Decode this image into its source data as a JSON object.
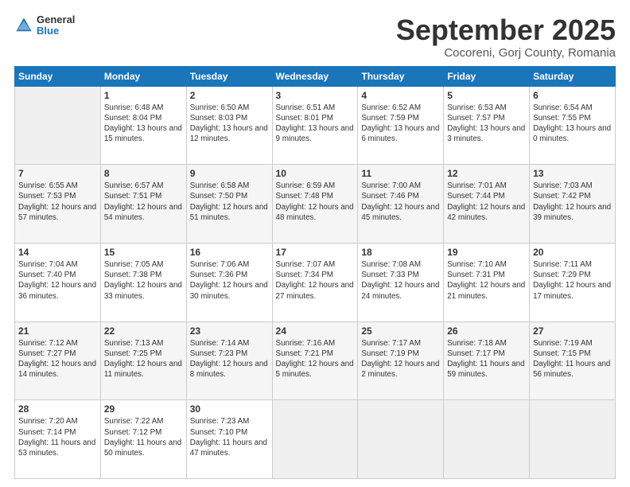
{
  "header": {
    "logo_general": "General",
    "logo_blue": "Blue",
    "month_title": "September 2025",
    "location": "Cocoreni, Gorj County, Romania"
  },
  "weekdays": [
    "Sunday",
    "Monday",
    "Tuesday",
    "Wednesday",
    "Thursday",
    "Friday",
    "Saturday"
  ],
  "weeks": [
    [
      {
        "day": "",
        "sunrise": "",
        "sunset": "",
        "daylight": ""
      },
      {
        "day": "1",
        "sunrise": "Sunrise: 6:48 AM",
        "sunset": "Sunset: 8:04 PM",
        "daylight": "Daylight: 13 hours and 15 minutes."
      },
      {
        "day": "2",
        "sunrise": "Sunrise: 6:50 AM",
        "sunset": "Sunset: 8:03 PM",
        "daylight": "Daylight: 13 hours and 12 minutes."
      },
      {
        "day": "3",
        "sunrise": "Sunrise: 6:51 AM",
        "sunset": "Sunset: 8:01 PM",
        "daylight": "Daylight: 13 hours and 9 minutes."
      },
      {
        "day": "4",
        "sunrise": "Sunrise: 6:52 AM",
        "sunset": "Sunset: 7:59 PM",
        "daylight": "Daylight: 13 hours and 6 minutes."
      },
      {
        "day": "5",
        "sunrise": "Sunrise: 6:53 AM",
        "sunset": "Sunset: 7:57 PM",
        "daylight": "Daylight: 13 hours and 3 minutes."
      },
      {
        "day": "6",
        "sunrise": "Sunrise: 6:54 AM",
        "sunset": "Sunset: 7:55 PM",
        "daylight": "Daylight: 13 hours and 0 minutes."
      }
    ],
    [
      {
        "day": "7",
        "sunrise": "Sunrise: 6:55 AM",
        "sunset": "Sunset: 7:53 PM",
        "daylight": "Daylight: 12 hours and 57 minutes."
      },
      {
        "day": "8",
        "sunrise": "Sunrise: 6:57 AM",
        "sunset": "Sunset: 7:51 PM",
        "daylight": "Daylight: 12 hours and 54 minutes."
      },
      {
        "day": "9",
        "sunrise": "Sunrise: 6:58 AM",
        "sunset": "Sunset: 7:50 PM",
        "daylight": "Daylight: 12 hours and 51 minutes."
      },
      {
        "day": "10",
        "sunrise": "Sunrise: 6:59 AM",
        "sunset": "Sunset: 7:48 PM",
        "daylight": "Daylight: 12 hours and 48 minutes."
      },
      {
        "day": "11",
        "sunrise": "Sunrise: 7:00 AM",
        "sunset": "Sunset: 7:46 PM",
        "daylight": "Daylight: 12 hours and 45 minutes."
      },
      {
        "day": "12",
        "sunrise": "Sunrise: 7:01 AM",
        "sunset": "Sunset: 7:44 PM",
        "daylight": "Daylight: 12 hours and 42 minutes."
      },
      {
        "day": "13",
        "sunrise": "Sunrise: 7:03 AM",
        "sunset": "Sunset: 7:42 PM",
        "daylight": "Daylight: 12 hours and 39 minutes."
      }
    ],
    [
      {
        "day": "14",
        "sunrise": "Sunrise: 7:04 AM",
        "sunset": "Sunset: 7:40 PM",
        "daylight": "Daylight: 12 hours and 36 minutes."
      },
      {
        "day": "15",
        "sunrise": "Sunrise: 7:05 AM",
        "sunset": "Sunset: 7:38 PM",
        "daylight": "Daylight: 12 hours and 33 minutes."
      },
      {
        "day": "16",
        "sunrise": "Sunrise: 7:06 AM",
        "sunset": "Sunset: 7:36 PM",
        "daylight": "Daylight: 12 hours and 30 minutes."
      },
      {
        "day": "17",
        "sunrise": "Sunrise: 7:07 AM",
        "sunset": "Sunset: 7:34 PM",
        "daylight": "Daylight: 12 hours and 27 minutes."
      },
      {
        "day": "18",
        "sunrise": "Sunrise: 7:08 AM",
        "sunset": "Sunset: 7:33 PM",
        "daylight": "Daylight: 12 hours and 24 minutes."
      },
      {
        "day": "19",
        "sunrise": "Sunrise: 7:10 AM",
        "sunset": "Sunset: 7:31 PM",
        "daylight": "Daylight: 12 hours and 21 minutes."
      },
      {
        "day": "20",
        "sunrise": "Sunrise: 7:11 AM",
        "sunset": "Sunset: 7:29 PM",
        "daylight": "Daylight: 12 hours and 17 minutes."
      }
    ],
    [
      {
        "day": "21",
        "sunrise": "Sunrise: 7:12 AM",
        "sunset": "Sunset: 7:27 PM",
        "daylight": "Daylight: 12 hours and 14 minutes."
      },
      {
        "day": "22",
        "sunrise": "Sunrise: 7:13 AM",
        "sunset": "Sunset: 7:25 PM",
        "daylight": "Daylight: 12 hours and 11 minutes."
      },
      {
        "day": "23",
        "sunrise": "Sunrise: 7:14 AM",
        "sunset": "Sunset: 7:23 PM",
        "daylight": "Daylight: 12 hours and 8 minutes."
      },
      {
        "day": "24",
        "sunrise": "Sunrise: 7:16 AM",
        "sunset": "Sunset: 7:21 PM",
        "daylight": "Daylight: 12 hours and 5 minutes."
      },
      {
        "day": "25",
        "sunrise": "Sunrise: 7:17 AM",
        "sunset": "Sunset: 7:19 PM",
        "daylight": "Daylight: 12 hours and 2 minutes."
      },
      {
        "day": "26",
        "sunrise": "Sunrise: 7:18 AM",
        "sunset": "Sunset: 7:17 PM",
        "daylight": "Daylight: 11 hours and 59 minutes."
      },
      {
        "day": "27",
        "sunrise": "Sunrise: 7:19 AM",
        "sunset": "Sunset: 7:15 PM",
        "daylight": "Daylight: 11 hours and 56 minutes."
      }
    ],
    [
      {
        "day": "28",
        "sunrise": "Sunrise: 7:20 AM",
        "sunset": "Sunset: 7:14 PM",
        "daylight": "Daylight: 11 hours and 53 minutes."
      },
      {
        "day": "29",
        "sunrise": "Sunrise: 7:22 AM",
        "sunset": "Sunset: 7:12 PM",
        "daylight": "Daylight: 11 hours and 50 minutes."
      },
      {
        "day": "30",
        "sunrise": "Sunrise: 7:23 AM",
        "sunset": "Sunset: 7:10 PM",
        "daylight": "Daylight: 11 hours and 47 minutes."
      },
      {
        "day": "",
        "sunrise": "",
        "sunset": "",
        "daylight": ""
      },
      {
        "day": "",
        "sunrise": "",
        "sunset": "",
        "daylight": ""
      },
      {
        "day": "",
        "sunrise": "",
        "sunset": "",
        "daylight": ""
      },
      {
        "day": "",
        "sunrise": "",
        "sunset": "",
        "daylight": ""
      }
    ]
  ]
}
